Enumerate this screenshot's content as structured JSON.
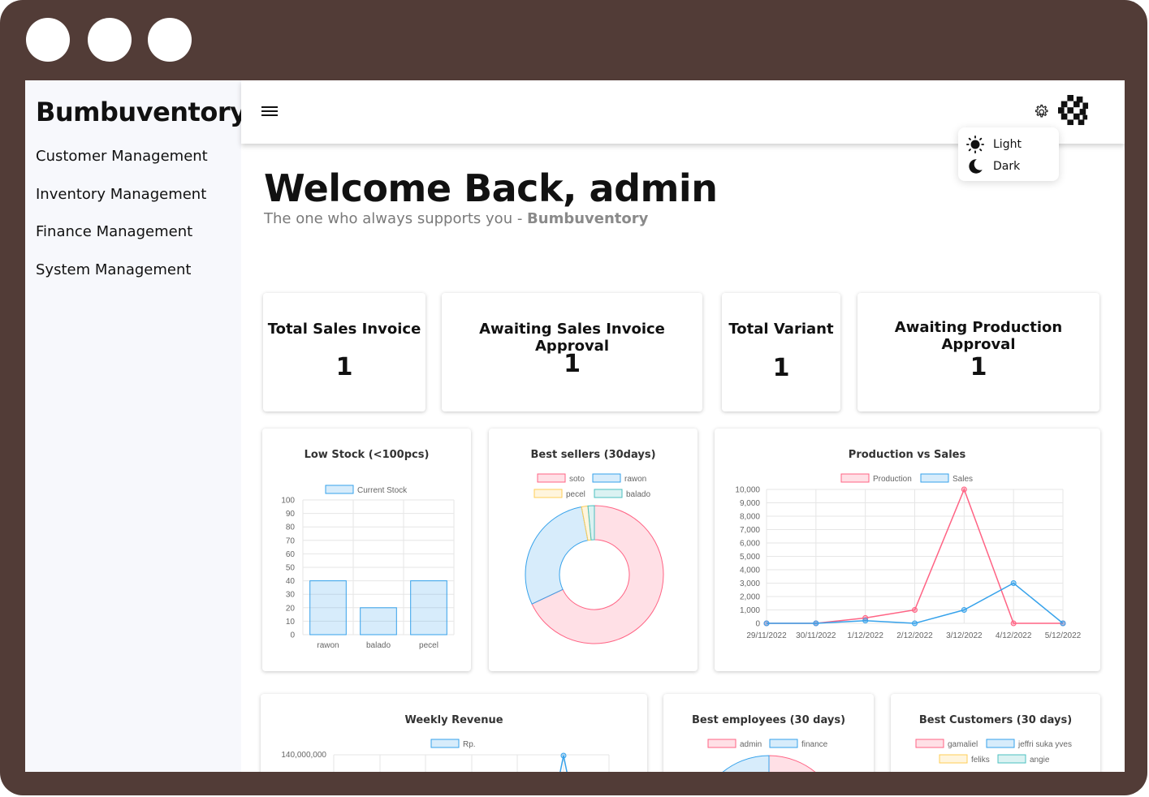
{
  "app": {
    "brand": "Bumbuventory",
    "nav": [
      {
        "label": "Customer Management"
      },
      {
        "label": "Inventory Management"
      },
      {
        "label": "Finance Management"
      },
      {
        "label": "System Management"
      }
    ]
  },
  "header": {
    "menu_icon": "hamburger-icon",
    "settings_icon": "gear-icon",
    "theme_menu": [
      {
        "label": "Light",
        "icon": "sun-icon"
      },
      {
        "label": "Dark",
        "icon": "moon-icon"
      }
    ]
  },
  "hero": {
    "title": "Welcome Back, admin",
    "subtitle_prefix": "The one who always supports you - ",
    "subtitle_brand": "Bumbuventory"
  },
  "stats": [
    {
      "title": "Total Sales Invoice",
      "value": "1"
    },
    {
      "title": "Awaiting Sales Invoice Approval",
      "value": "1"
    },
    {
      "title": "Total Variant",
      "value": "1"
    },
    {
      "title": "Awaiting Production Approval",
      "value": "1"
    }
  ],
  "colors": {
    "red": "#ff6384",
    "blue": "#36a2eb",
    "yellow": "#ffce56",
    "teal": "#4bc0c0",
    "frame": "#523c37"
  },
  "chart_data": [
    {
      "type": "bar",
      "title": "Low Stock (<100pcs)",
      "categories": [
        "rawon",
        "balado",
        "pecel"
      ],
      "series": [
        {
          "name": "Current Stock",
          "values": [
            40,
            20,
            40
          ]
        }
      ],
      "ylim": [
        0,
        100
      ],
      "yticks": [
        "100",
        "90",
        "80",
        "70",
        "60",
        "50",
        "40",
        "30",
        "20",
        "10",
        "0"
      ],
      "legend": "top",
      "grid": true
    },
    {
      "type": "pie",
      "title": "Best sellers (30days)",
      "labels": [
        "soto",
        "rawon",
        "pecel",
        "balado"
      ],
      "values": [
        68,
        29,
        1.5,
        1.5
      ],
      "legend": "top"
    },
    {
      "type": "line",
      "title": "Production vs Sales",
      "x": [
        "29/11/2022",
        "30/11/2022",
        "1/12/2022",
        "2/12/2022",
        "3/12/2022",
        "4/12/2022",
        "5/12/2022"
      ],
      "series": [
        {
          "name": "Production",
          "values": [
            0,
            0,
            400,
            1000,
            10000,
            0,
            0
          ]
        },
        {
          "name": "Sales",
          "values": [
            0,
            0,
            200,
            0,
            1000,
            3000,
            0
          ]
        }
      ],
      "ylim": [
        0,
        10000
      ],
      "yticks": [
        "10,000",
        "9,000",
        "8,000",
        "7,000",
        "6,000",
        "5,000",
        "4,000",
        "3,000",
        "2,000",
        "1,000",
        "0"
      ],
      "legend": "top",
      "grid": true
    },
    {
      "type": "line",
      "title": "Weekly Revenue",
      "series": [
        {
          "name": "Rp."
        }
      ],
      "yticks": [
        "140,000,000"
      ],
      "legend": "top"
    },
    {
      "type": "pie",
      "title": "Best employees (30 days)",
      "labels": [
        "admin",
        "finance"
      ],
      "values": [
        50,
        50
      ],
      "legend": "top"
    },
    {
      "type": "pie",
      "title": "Best Customers (30 days)",
      "labels": [
        "gamaliel",
        "jeffri suka yves",
        "feliks",
        "angie"
      ],
      "legend": "top"
    }
  ]
}
